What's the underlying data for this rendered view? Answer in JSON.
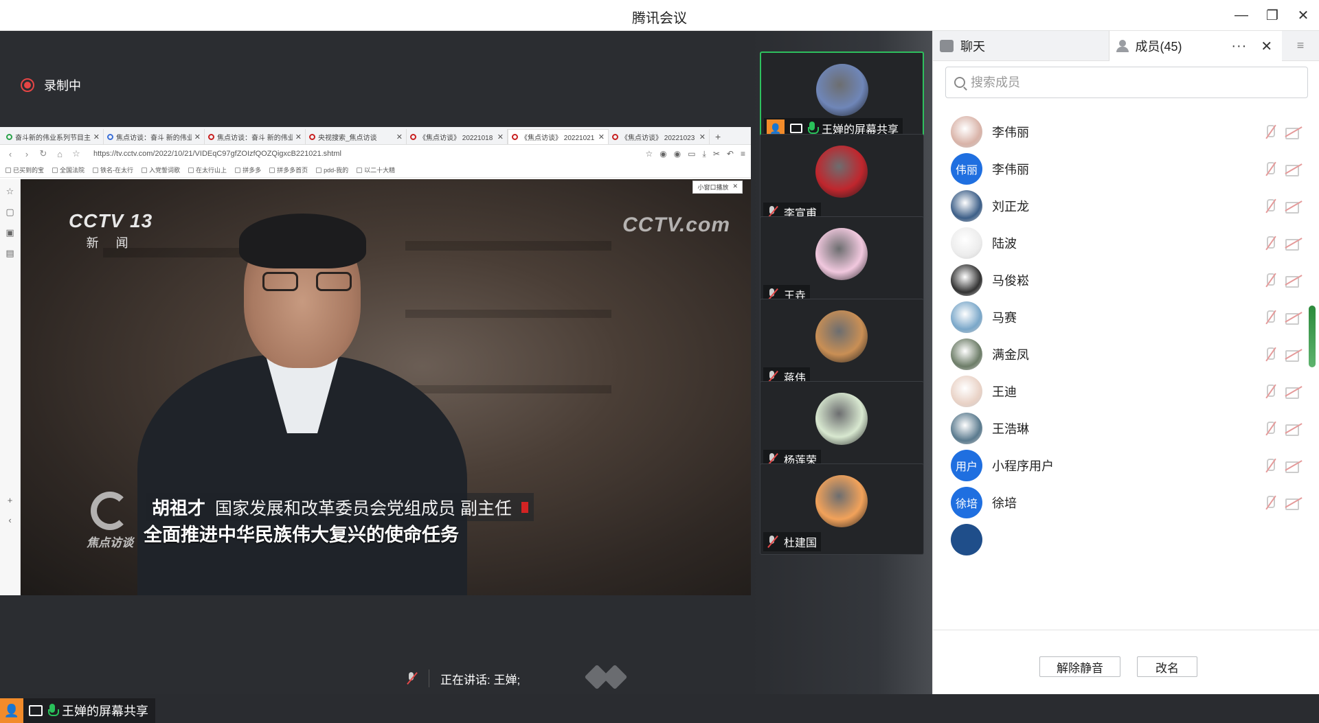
{
  "window": {
    "title": "腾讯会议"
  },
  "recording": {
    "label": "录制中"
  },
  "browser": {
    "tabs": [
      {
        "title": "奋斗新的伟业系列节目主",
        "fav": "g"
      },
      {
        "title": "焦点访谈：奋斗 新的伟业",
        "fav": "b"
      },
      {
        "title": "焦点访谈：奋斗 新的伟业",
        "fav": "r"
      },
      {
        "title": "央视搜索_焦点访谈",
        "fav": "r"
      },
      {
        "title": "《焦点访谈》 20221018",
        "fav": "r"
      },
      {
        "title": "《焦点访谈》 20221021",
        "fav": "r"
      },
      {
        "title": "《焦点访谈》 20221023",
        "fav": "r"
      }
    ],
    "new_tab": "+",
    "url": "https://tv.cctv.com/2022/10/21/VIDEqC97gfZOIzfQOZQigxcB221021.shtml",
    "bookmarks": [
      "已买到的宝",
      "全国法院",
      "铁名-在太行",
      "入党誓词歌",
      "在太行山上",
      "拼多多",
      "拼多多首页",
      "pdd-我的",
      "以二十大精"
    ],
    "mini_play": "小窗口播放"
  },
  "video": {
    "logo_left_top": "CCTV 13",
    "logo_left_bottom": "新 闻",
    "logo_right": "CCTV.com",
    "program_logo": "焦点访谈",
    "speaker_name": "胡祖才",
    "speaker_title": "国家发展和改革委员会党组成员 副主任",
    "caption": "全面推进中华民族伟大复兴的使命任务"
  },
  "status": {
    "speaking": "正在讲话: 王婵;"
  },
  "share_tag": {
    "label": "王婵的屏幕共享"
  },
  "participants": [
    {
      "name": "王婵的屏幕共享",
      "avatar": "#6f86b8",
      "active": true
    },
    {
      "name": "李宣甫",
      "avatar": "#c0262d"
    },
    {
      "name": "王垚",
      "avatar": "#f1c8de"
    },
    {
      "name": "蒋伟",
      "avatar": "#c98f55"
    },
    {
      "name": "杨莲荣",
      "avatar": "#d8e8d0"
    },
    {
      "name": "杜建国",
      "avatar": "#f2a25a"
    }
  ],
  "panel": {
    "tab_chat": "聊天",
    "tab_members": "成员(45)",
    "search_placeholder": "搜索成员",
    "members": [
      {
        "name": "李伟丽",
        "avatar_text": "",
        "color": "#d9b3a8"
      },
      {
        "name": "李伟丽",
        "avatar_text": "伟丽",
        "color": "#1f6fe0"
      },
      {
        "name": "刘正龙",
        "avatar_text": "",
        "color": "#3d5f88"
      },
      {
        "name": "陆波",
        "avatar_text": "",
        "color": "#ececec"
      },
      {
        "name": "马俊崧",
        "avatar_text": "",
        "color": "#333333"
      },
      {
        "name": "马赛",
        "avatar_text": "",
        "color": "#7aa7c9"
      },
      {
        "name": "满金凤",
        "avatar_text": "",
        "color": "#6d7d68"
      },
      {
        "name": "王迪",
        "avatar_text": "",
        "color": "#e9d2c6"
      },
      {
        "name": "王浩琳",
        "avatar_text": "",
        "color": "#5a7a8e"
      },
      {
        "name": "小程序用户",
        "avatar_text": "用户",
        "color": "#1f6fe0"
      },
      {
        "name": "徐培",
        "avatar_text": "徐培",
        "color": "#1f6fe0"
      }
    ],
    "unmute_all": "解除静音",
    "rename": "改名"
  }
}
